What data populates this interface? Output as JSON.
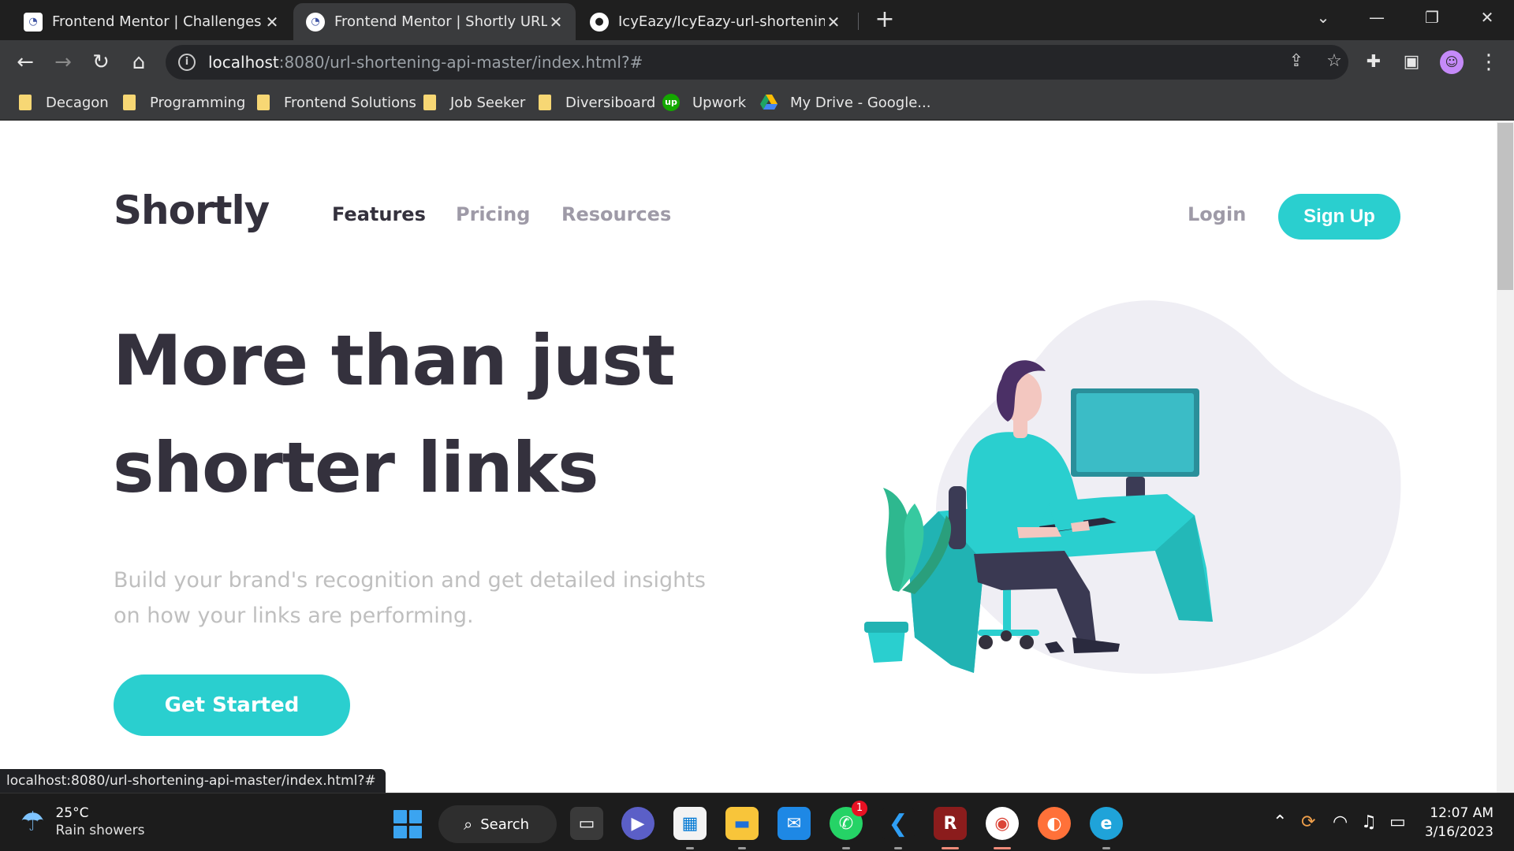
{
  "browser": {
    "tabs": [
      {
        "title": "Frontend Mentor | Challenges",
        "active": false
      },
      {
        "title": "Frontend Mentor | Shortly URL sh",
        "active": true
      },
      {
        "title": "IcyEazy/IcyEazy-url-shortening-ap",
        "active": false
      }
    ],
    "new_tab": "+",
    "address": {
      "host": "localhost",
      "rest": ":8080/url-shortening-api-master/index.html?#"
    },
    "bookmarks": [
      {
        "label": "Decagon",
        "icon": "folder-icon"
      },
      {
        "label": "Programming",
        "icon": "folder-icon"
      },
      {
        "label": "Frontend Solutions",
        "icon": "folder-icon"
      },
      {
        "label": "Job Seeker",
        "icon": "folder-icon"
      },
      {
        "label": "Diversiboard",
        "icon": "folder-icon"
      },
      {
        "label": "Upwork",
        "icon": "upwork-icon"
      },
      {
        "label": "My Drive - Google...",
        "icon": "google-drive-icon"
      }
    ],
    "status_url": "localhost:8080/url-shortening-api-master/index.html?#"
  },
  "site": {
    "logo": "Shortly",
    "nav": [
      "Features",
      "Pricing",
      "Resources"
    ],
    "login": "Login",
    "signup": "Sign Up",
    "hero_title": "More than just shorter links",
    "hero_subtitle": "Build your brand's recognition and get detailed insights on how your links are performing.",
    "cta": "Get Started",
    "colors": {
      "primary": "#2acfcf",
      "dark": "#34313d",
      "gray": "#9e9aa7",
      "blob": "#efeef4"
    }
  },
  "taskbar": {
    "weather": {
      "temp": "25°C",
      "desc": "Rain showers"
    },
    "search": "Search",
    "whatsapp_badge": "1",
    "clock": {
      "time": "12:07 AM",
      "date": "3/16/2023"
    }
  }
}
